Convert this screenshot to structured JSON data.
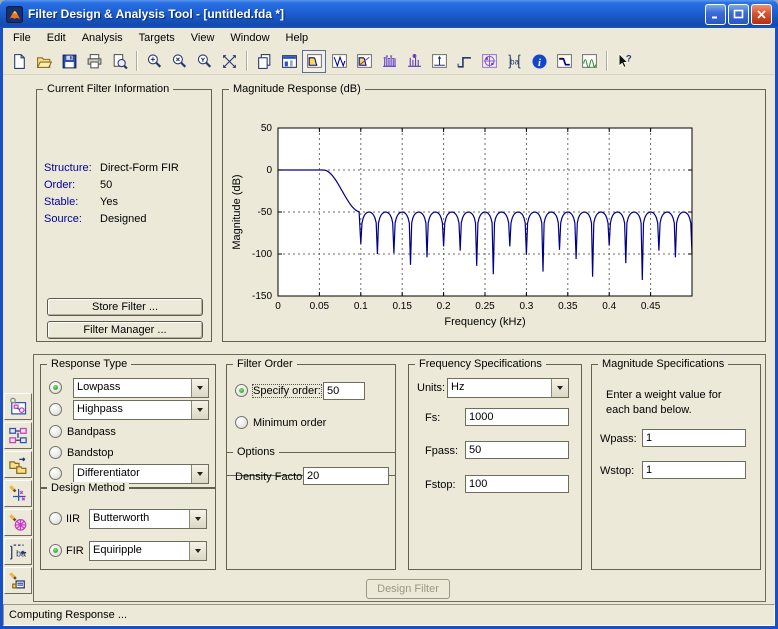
{
  "window": {
    "title": "Filter Design & Analysis Tool -  [untitled.fda *]",
    "app_icon": "matlab-logo"
  },
  "menu": {
    "items": [
      "File",
      "Edit",
      "Analysis",
      "Targets",
      "View",
      "Window",
      "Help"
    ]
  },
  "toolbar": {
    "buttons": [
      {
        "icon": "new-session"
      },
      {
        "icon": "open-session"
      },
      {
        "icon": "save-session"
      },
      {
        "icon": "print"
      },
      {
        "icon": "print-preview"
      },
      {
        "sep": true
      },
      {
        "icon": "zoom-in"
      },
      {
        "icon": "zoom-x"
      },
      {
        "icon": "zoom-y"
      },
      {
        "icon": "full-view"
      },
      {
        "sep": true
      },
      {
        "icon": "copy-pages"
      },
      {
        "icon": "figure-window"
      },
      {
        "icon": "magnitude-response",
        "selected": true
      },
      {
        "icon": "phase-response"
      },
      {
        "icon": "magnitude-phase-response"
      },
      {
        "icon": "group-delay"
      },
      {
        "icon": "phase-delay"
      },
      {
        "icon": "impulse-response"
      },
      {
        "icon": "step-response"
      },
      {
        "icon": "pole-zero-plot"
      },
      {
        "icon": "filter-coefficients"
      },
      {
        "icon": "filter-information"
      },
      {
        "icon": "filter-specifications"
      },
      {
        "icon": "spectral-mask"
      },
      {
        "sep": true
      },
      {
        "icon": "context-help"
      }
    ]
  },
  "sidebar": {
    "buttons": [
      {
        "icon": "transform-filter"
      },
      {
        "icon": "multirate-filter"
      },
      {
        "icon": "convert-structure"
      },
      {
        "icon": "pole-zero-editor"
      },
      {
        "icon": "quantization"
      },
      {
        "icon": "import-filter"
      },
      {
        "icon": "realize-model"
      }
    ]
  },
  "current_filter_info": {
    "title": "Current Filter Information",
    "rows": [
      {
        "label": "Structure:",
        "value": "Direct-Form FIR"
      },
      {
        "label": "Order:",
        "value": "50"
      },
      {
        "label": "Stable:",
        "value": "Yes"
      },
      {
        "label": "Source:",
        "value": "Designed"
      }
    ],
    "store_button": "Store Filter ...",
    "manager_button": "Filter Manager ..."
  },
  "magnitude_response": {
    "title": "Magnitude Response (dB)"
  },
  "chart_data": {
    "type": "line",
    "title": "Magnitude Response (dB)",
    "xlabel": "Frequency (kHz)",
    "ylabel": "Magnitude (dB)",
    "xlim": [
      0,
      0.5
    ],
    "ylim": [
      -150,
      50
    ],
    "xticks": [
      0,
      0.05,
      0.1,
      0.15,
      0.2,
      0.25,
      0.3,
      0.35,
      0.4,
      0.45
    ],
    "xtick_labels": [
      "0",
      "0.05",
      "0.1",
      "0.15",
      "0.2",
      "0.25",
      "0.3",
      "0.35",
      "0.4",
      "0.45"
    ],
    "yticks": [
      50,
      0,
      -50,
      -100,
      -150
    ],
    "grid": true,
    "legend": "none",
    "series": [
      {
        "name": "lowpass-fir-equiripple-magnitude",
        "color": "#00008B",
        "passband_db": 0,
        "passband_edge_khz": 0.055,
        "stopband_edge_khz": 0.1,
        "stopband_peak_db": -50,
        "stopband_lobe_width_khz": 0.02,
        "notch_depths_db": [
          -88,
          -100,
          -99,
          -113,
          -104,
          -91,
          -96,
          -114,
          -124,
          -91,
          -101,
          -121,
          -95,
          -106,
          -127,
          -90,
          -111,
          -131,
          -96,
          -104,
          -100
        ]
      }
    ]
  },
  "design_panel": {
    "response_type": {
      "title": "Response Type",
      "radios": [
        {
          "label": "Lowpass",
          "combo": true,
          "selected": true
        },
        {
          "label": "Highpass",
          "combo": true
        },
        {
          "label": "Bandpass"
        },
        {
          "label": "Bandstop"
        },
        {
          "label": "Differentiator",
          "combo": true
        }
      ]
    },
    "design_method": {
      "title": "Design Method",
      "radios": [
        {
          "label": "IIR",
          "combo_value": "Butterworth"
        },
        {
          "label": "FIR",
          "combo_value": "Equiripple",
          "selected": true
        }
      ]
    },
    "filter_order": {
      "title": "Filter Order",
      "specify_label": "Specify order:",
      "specify_value": "50",
      "specify_selected": true,
      "minimum_label": "Minimum order"
    },
    "options": {
      "title": "Options",
      "density_label": "Density Factor:",
      "density_value": "20"
    },
    "frequency_specifications": {
      "title": "Frequency Specifications",
      "units_label": "Units:",
      "units_value": "Hz",
      "fields": [
        {
          "label": "Fs:",
          "value": "1000"
        },
        {
          "label": "Fpass:",
          "value": "50"
        },
        {
          "label": "Fstop:",
          "value": "100"
        }
      ]
    },
    "magnitude_specifications": {
      "title": "Magnitude Specifications",
      "note_line1": "Enter a weight value for",
      "note_line2": "each band below.",
      "fields": [
        {
          "label": "Wpass:",
          "value": "1"
        },
        {
          "label": "Wstop:",
          "value": "1"
        }
      ]
    },
    "design_filter_button": {
      "label": "Design Filter",
      "enabled": false
    }
  },
  "status_bar": {
    "text": "Computing Response ..."
  },
  "colors": {
    "titlebar_blue": "#1C5FD2",
    "window_border": "#1850C8",
    "panel_beige": "#ECE9D8",
    "curve_navy": "#00008B",
    "info_label_blue": "#00009B",
    "close_red": "#C83C1E"
  }
}
